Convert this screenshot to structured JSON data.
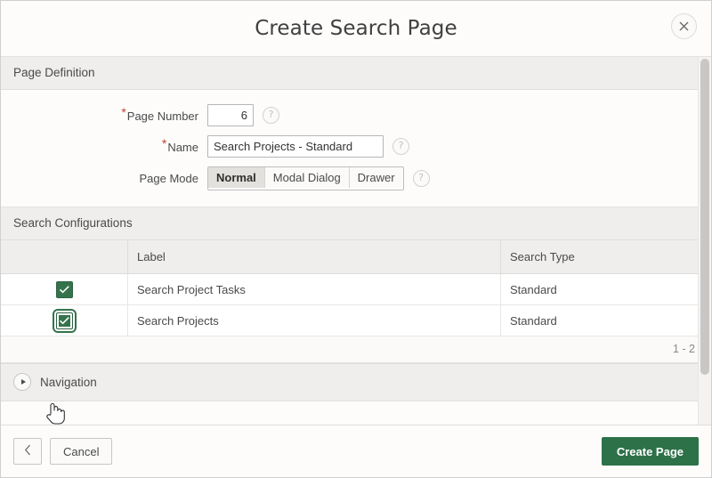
{
  "dialog": {
    "title": "Create Search Page",
    "close_icon": "close-icon"
  },
  "page_definition": {
    "header": "Page Definition",
    "fields": {
      "page_number": {
        "label": "Page Number",
        "required_marker": "*",
        "value": "6",
        "help_icon": "?"
      },
      "name": {
        "label": "Name",
        "required_marker": "*",
        "value": "Search Projects - Standard",
        "placeholder": "",
        "help_icon": "?"
      },
      "page_mode": {
        "label": "Page Mode",
        "options": [
          "Normal",
          "Modal Dialog",
          "Drawer"
        ],
        "selected": "Normal",
        "help_icon": "?"
      }
    }
  },
  "search_configurations": {
    "header": "Search Configurations",
    "columns": [
      "",
      "Label",
      "Search Type"
    ],
    "rows": [
      {
        "checked": true,
        "focused": false,
        "label": "Search Project Tasks",
        "search_type": "Standard"
      },
      {
        "checked": true,
        "focused": true,
        "label": "Search Projects",
        "search_type": "Standard"
      }
    ],
    "pagination": "1 - 2"
  },
  "navigation": {
    "header": "Navigation",
    "expanded": false
  },
  "footer": {
    "back_label": "‹",
    "cancel_label": "Cancel",
    "create_label": "Create Page"
  },
  "colors": {
    "accent_green": "#2d7149",
    "checkbox_green": "#35734c",
    "required_red": "#c0432e",
    "region_header_bg": "#efeeec",
    "dialog_bg": "#fdfcfb"
  }
}
